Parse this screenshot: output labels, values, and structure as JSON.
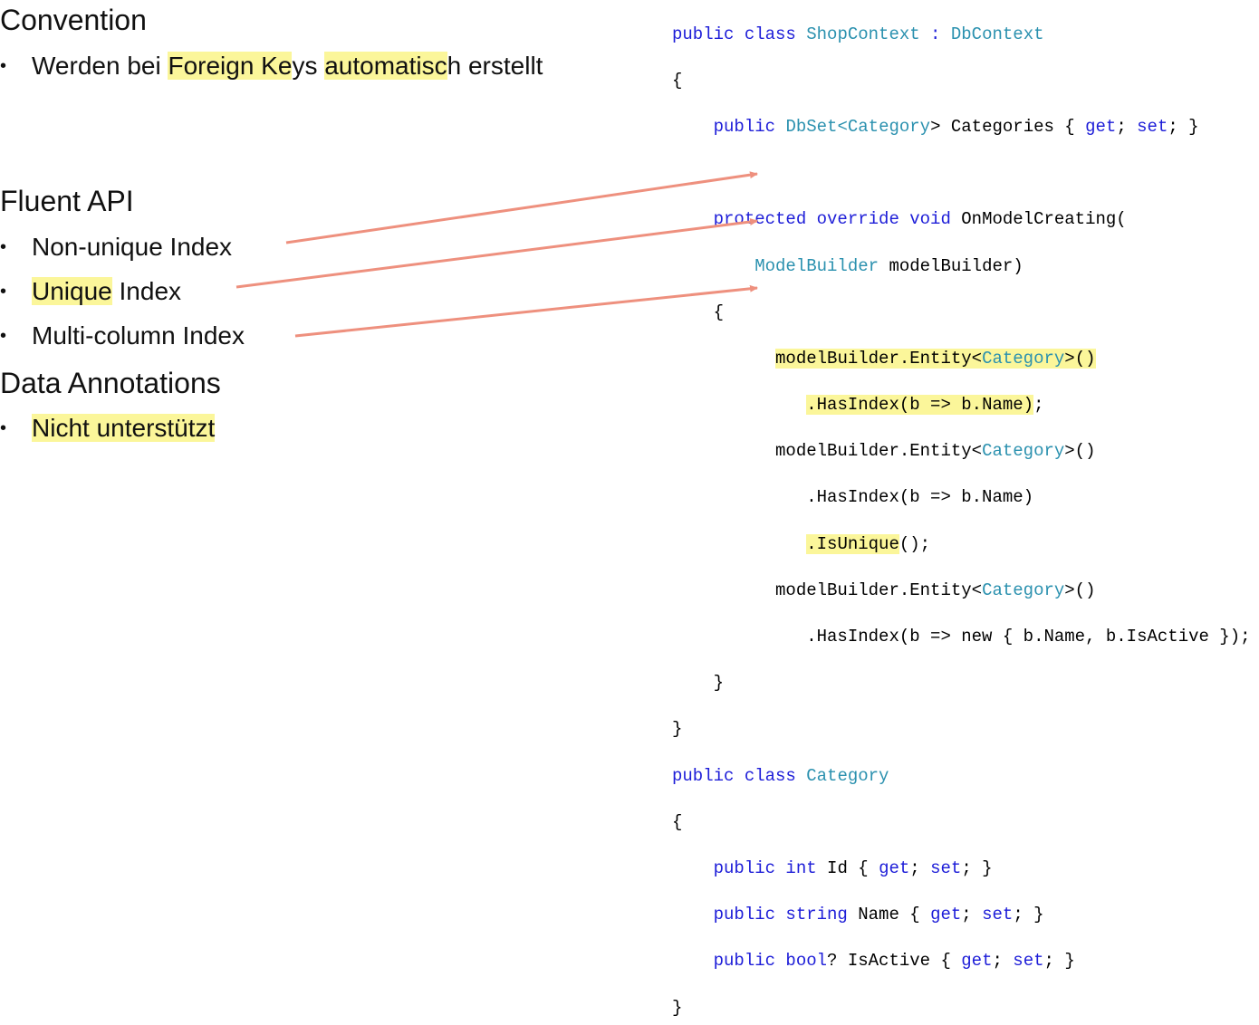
{
  "left": {
    "convention_heading": "Convention",
    "convention_bullet": {
      "prefix": "Werden bei ",
      "hl1": "Foreign Ke",
      "mid1": "ys ",
      "hl2": "automatisc",
      "mid2": "h erstellt"
    },
    "fluent_heading": "Fluent API",
    "fluent_items": {
      "nonunique": "Non-unique Index",
      "unique_hl": "Unique",
      "unique_rest": " Index",
      "multicol": "Multi-column Index"
    },
    "annotations_heading": "Data Annotations",
    "annotations_bullet": "Nicht unterstützt",
    "bullet_char": "•"
  },
  "code": {
    "l1": {
      "a": "public class ",
      "b": "ShopContext",
      "c": " : ",
      "d": "DbContext"
    },
    "l2": "{",
    "l3": {
      "a": "    ",
      "b": "public",
      "c": " ",
      "d": "DbSet",
      "e": "<",
      "f": "Category",
      "g": "> Categories { ",
      "h": "get",
      "i": "; ",
      "j": "set",
      "k": "; }"
    },
    "l4": "",
    "l5": {
      "a": "    ",
      "b": "protected override void",
      "c": " OnModelCreating("
    },
    "l6": {
      "a": "        ",
      "b": "ModelBuilder",
      "c": " modelBuilder)"
    },
    "l7": "    {",
    "l8": {
      "a": "          ",
      "b": "modelBuilder.Entity<",
      "c": "Category",
      "d": ">()"
    },
    "l9": {
      "a": "             ",
      "b": ".HasIndex(b => b.Name)",
      "c": ";"
    },
    "l10": {
      "a": "          modelBuilder.Entity<",
      "b": "Category",
      "c": ">()"
    },
    "l11": "             .HasIndex(b => b.Name)",
    "l12": {
      "a": "             ",
      "b": ".IsUnique",
      "c": "();"
    },
    "l13": {
      "a": "          modelBuilder.Entity<",
      "b": "Category",
      "c": ">()"
    },
    "l14": "             .HasIndex(b => new { b.Name, b.IsActive });",
    "l15": "    }",
    "l16": "}",
    "l17": {
      "a": "public class ",
      "b": "Category"
    },
    "l18": "{",
    "l19": {
      "a": "    ",
      "b": "public int",
      "c": " Id { ",
      "d": "get",
      "e": "; ",
      "f": "set",
      "g": "; }"
    },
    "l20": {
      "a": "    ",
      "b": "public string",
      "c": " Name { ",
      "d": "get",
      "e": "; ",
      "f": "set",
      "g": "; }"
    },
    "l21": {
      "a": "    ",
      "b": "public bool",
      "c": "? IsActive { ",
      "d": "get",
      "e": "; ",
      "f": "set",
      "g": "; }"
    },
    "l22": "}"
  },
  "colors": {
    "highlight": "#fbf69a",
    "keyword": "#1d1dd8",
    "type": "#2b91af",
    "arrow": "#ee907e"
  }
}
